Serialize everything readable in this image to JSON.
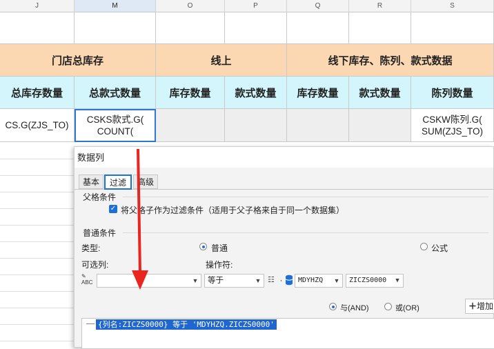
{
  "columns": [
    "J",
    "M",
    "O",
    "P",
    "Q",
    "R",
    "S"
  ],
  "header_row1": {
    "store_total": "门店总库存",
    "online": "线上",
    "offline": "线下库存、陈列、款式数据"
  },
  "header_row2": [
    "总库存数量",
    "总款式数量",
    "库存数量",
    "款式数量",
    "库存数量",
    "款式数量",
    "陈列数量"
  ],
  "data_row": {
    "j": "CS.G(ZJS_TO)",
    "m_line1": "CSKS款式.G(",
    "m_line2": "COUNT(",
    "s_line1": "CSKW陈列.G(",
    "s_line2": "SUM(ZJS_TO)"
  },
  "dialog": {
    "title": "数据列",
    "tabs": [
      "基本",
      "过滤",
      "高级"
    ],
    "active_tab": "过滤",
    "parent_section": "父格条件",
    "parent_checkbox": "将父格子作为过滤条件（适用于父子格来自于同一个数据集）",
    "parent_checked": true,
    "normal_section": "普通条件",
    "type_label": "类型:",
    "type_normal": "普通",
    "type_formula": "公式",
    "type_selected": "普通",
    "optional_label": "可选列:",
    "operator_label": "操作符:",
    "optional_value": "",
    "operator_value": "等于",
    "dataset_value": "MDYHZQ",
    "column_value": "ZICZS0000",
    "logic_and": "与(AND)",
    "logic_or": "或(OR)",
    "logic_selected": "与(AND)",
    "add_button": "增加",
    "condition_item": "{列名:ZICZS0000} 等于 'MDYHZQ.ZICZS0000'"
  },
  "accent_color": "#1e6fd9",
  "annotation_color": "#e8251f"
}
